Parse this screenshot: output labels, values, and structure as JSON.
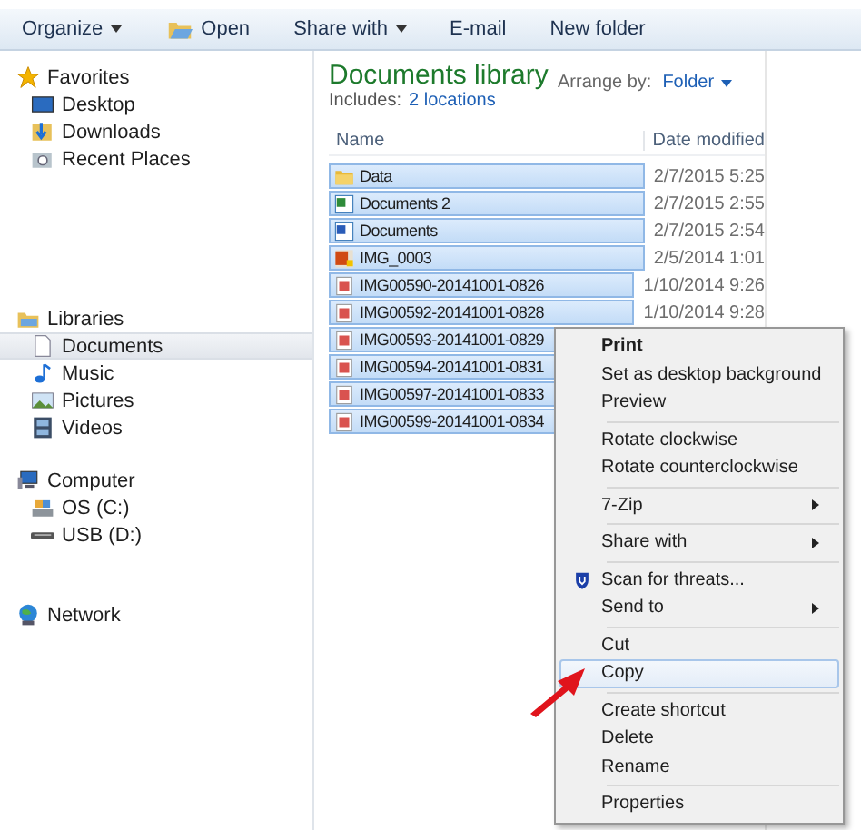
{
  "toolbar": [
    {
      "label": "Organize",
      "kind": "menu"
    },
    {
      "label": "Open",
      "kind": "icon"
    },
    {
      "label": "Share with",
      "kind": "menu"
    },
    {
      "label": "E-mail",
      "kind": "plain"
    },
    {
      "label": "New folder",
      "kind": "plain"
    }
  ],
  "sidebar": [
    {
      "label": "Favorites",
      "kind": "star",
      "children": [
        {
          "label": "Desktop",
          "kind": "desktop",
          "selected": false
        },
        {
          "label": "Downloads",
          "kind": "downloads",
          "selected": false
        },
        {
          "label": "Recent Places",
          "kind": "recent",
          "selected": false
        }
      ]
    },
    {
      "label": "Libraries",
      "kind": "library",
      "children": [
        {
          "label": "Documents",
          "kind": "document",
          "selected": true
        },
        {
          "label": "Music",
          "kind": "music",
          "selected": false
        },
        {
          "label": "Pictures",
          "kind": "pictures",
          "selected": false
        },
        {
          "label": "Videos",
          "kind": "videos",
          "selected": false
        }
      ]
    },
    {
      "label": "Computer",
      "kind": "computer",
      "children": [
        {
          "label": "OS (C:)",
          "kind": "disk",
          "selected": false
        },
        {
          "label": "USB (D:)",
          "kind": "usb",
          "selected": false
        }
      ]
    },
    {
      "label": "Network",
      "kind": "network"
    }
  ],
  "library": {
    "title": "Documents library",
    "includes_label": "Includes:",
    "includes_link": "2 locations",
    "arrange_label": "Arrange by:",
    "arrange_value": "Folder"
  },
  "columns": [
    "Name",
    "Date modified"
  ],
  "files": [
    {
      "name": "Data",
      "kind": "folder",
      "date": "2/7/2015 5:25",
      "selected": true
    },
    {
      "name": "Documents 2",
      "kind": "sheet",
      "date": "2/7/2015 2:55",
      "selected": true
    },
    {
      "name": "Documents",
      "kind": "doc",
      "date": "2/7/2015 2:54",
      "selected": true
    },
    {
      "name": "IMG_0003",
      "kind": "media",
      "date": "2/5/2014 1:01",
      "selected": true
    },
    {
      "name": "IMG00590-20141001-0826",
      "kind": "image",
      "date": "1/10/2014 9:26",
      "selected": true
    },
    {
      "name": "IMG00592-20141001-0828",
      "kind": "image",
      "date": "1/10/2014 9:28",
      "selected": true
    },
    {
      "name": "IMG00593-20141001-0829",
      "kind": "image",
      "selected": true
    },
    {
      "name": "IMG00594-20141001-0831",
      "kind": "image",
      "selected": true
    },
    {
      "name": "IMG00597-20141001-0833",
      "kind": "image",
      "selected": true
    },
    {
      "name": "IMG00599-20141001-0834",
      "kind": "image",
      "selected": true
    }
  ],
  "context_menu": [
    [
      {
        "label": "Print",
        "kind": "plain",
        "default": true,
        "submenu": false,
        "selected": false
      },
      {
        "label": "Set as desktop background",
        "kind": "plain",
        "default": false,
        "submenu": false,
        "selected": false
      },
      {
        "label": "Preview",
        "kind": "plain",
        "default": false,
        "submenu": false,
        "selected": false
      }
    ],
    [
      {
        "label": "Rotate clockwise",
        "kind": "plain",
        "default": false,
        "submenu": false,
        "selected": false
      },
      {
        "label": "Rotate counterclockwise",
        "kind": "plain",
        "default": false,
        "submenu": false,
        "selected": false
      }
    ],
    [
      {
        "label": "7-Zip",
        "kind": "plain",
        "default": false,
        "submenu": true,
        "selected": false
      }
    ],
    [
      {
        "label": "Share with",
        "kind": "plain",
        "default": false,
        "submenu": true,
        "selected": false
      }
    ],
    [
      {
        "label": "Scan for threats...",
        "kind": "shield",
        "default": false,
        "submenu": false,
        "selected": false
      },
      {
        "label": "Send to",
        "kind": "plain",
        "default": false,
        "submenu": true,
        "selected": false
      }
    ],
    [
      {
        "label": "Cut",
        "kind": "plain",
        "default": false,
        "submenu": false,
        "selected": false
      },
      {
        "label": "Copy",
        "kind": "plain",
        "default": false,
        "submenu": false,
        "selected": true
      }
    ],
    [
      {
        "label": "Create shortcut",
        "kind": "plain",
        "default": false,
        "submenu": false,
        "selected": false
      },
      {
        "label": "Delete",
        "kind": "plain",
        "default": false,
        "submenu": false,
        "selected": false
      },
      {
        "label": "Rename",
        "kind": "plain",
        "default": false,
        "submenu": false,
        "selected": false
      }
    ],
    [
      {
        "label": "Properties",
        "kind": "plain",
        "default": false,
        "submenu": false,
        "selected": false
      }
    ]
  ]
}
